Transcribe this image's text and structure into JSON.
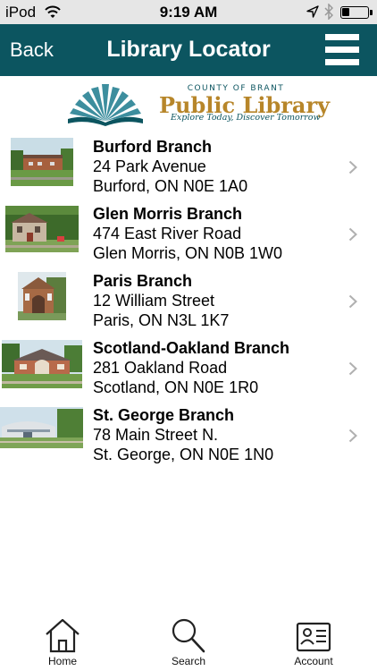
{
  "status_bar": {
    "carrier": "iPod",
    "time": "9:19 AM"
  },
  "nav": {
    "back_label": "Back",
    "title": "Library Locator"
  },
  "logo": {
    "county": "COUNTY OF BRANT",
    "name": "Public Library",
    "tagline": "Explore Today, Discover Tomorrow"
  },
  "branches": [
    {
      "name": "Burford Branch",
      "street": "24 Park Avenue",
      "city": "Burford, ON N0E 1A0"
    },
    {
      "name": "Glen Morris Branch",
      "street": "474 East River Road",
      "city": "Glen Morris, ON N0B 1W0"
    },
    {
      "name": "Paris Branch",
      "street": "12 William Street",
      "city": "Paris, ON N3L 1K7"
    },
    {
      "name": "Scotland-Oakland Branch",
      "street": "281 Oakland Road",
      "city": "Scotland, ON N0E 1R0"
    },
    {
      "name": "St. George Branch",
      "street": "78 Main Street N.",
      "city": "St. George, ON N0E 1N0"
    }
  ],
  "tabs": [
    {
      "label": "Home",
      "icon": "home-icon"
    },
    {
      "label": "Search",
      "icon": "search-icon"
    },
    {
      "label": "Account",
      "icon": "account-card-icon"
    }
  ],
  "colors": {
    "nav_background": "#0c5560",
    "logo_gold": "#b7862a",
    "status_bar": "#e6e6e6"
  }
}
